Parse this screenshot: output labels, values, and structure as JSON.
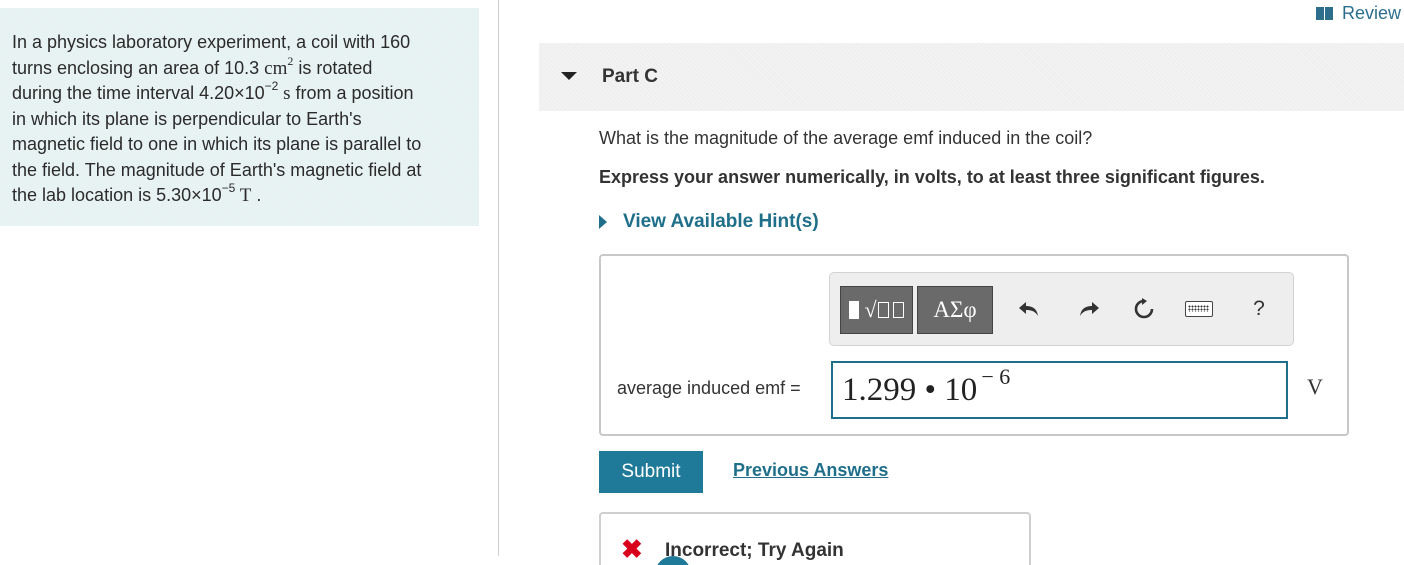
{
  "problem": {
    "line1": "In a physics laboratory experiment, a coil with 160",
    "line2_pre": "turns enclosing an area of 10.3 ",
    "area_unit": "cm",
    "area_unit_exp": "2",
    "line2_post": " is rotated",
    "line3_pre": "during the time interval 4.20×10",
    "time_exp": "−2",
    "time_unit": " s",
    "line3_post": " from a position",
    "line4": "in which its plane is perpendicular to Earth's",
    "line5": "magnetic field to one in which its plane is parallel to",
    "line6": "the field. The magnitude of Earth's magnetic field at",
    "line7_pre": "the lab location is 5.30×10",
    "field_exp": "−5",
    "field_unit": " T",
    "line7_post": " ."
  },
  "header": {
    "review_label": "Review"
  },
  "part": {
    "title": "Part C",
    "question": "What is the magnitude of the average emf induced in the coil?",
    "instruction": "Express your answer numerically, in volts, to at least three significant figures.",
    "hints_label": "View Available Hint(s)"
  },
  "toolbar": {
    "symbols_label": "ΑΣφ",
    "undo_icon": "undo-icon",
    "redo_icon": "redo-icon",
    "reset_icon": "reset-icon",
    "keyboard_icon": "keyboard-icon",
    "help_label": "?"
  },
  "answer": {
    "label": "average induced emf =",
    "mantissa": "1.299 • 10",
    "exponent": "− 6",
    "unit": "V"
  },
  "actions": {
    "submit_label": "Submit",
    "previous_label": "Previous Answers"
  },
  "feedback": {
    "icon": "✖",
    "message": "Incorrect; Try Again"
  },
  "colors": {
    "accent": "#1f7a99",
    "link": "#1f6f8b",
    "error": "#d8001a",
    "problem_bg": "#e6f1f1"
  }
}
